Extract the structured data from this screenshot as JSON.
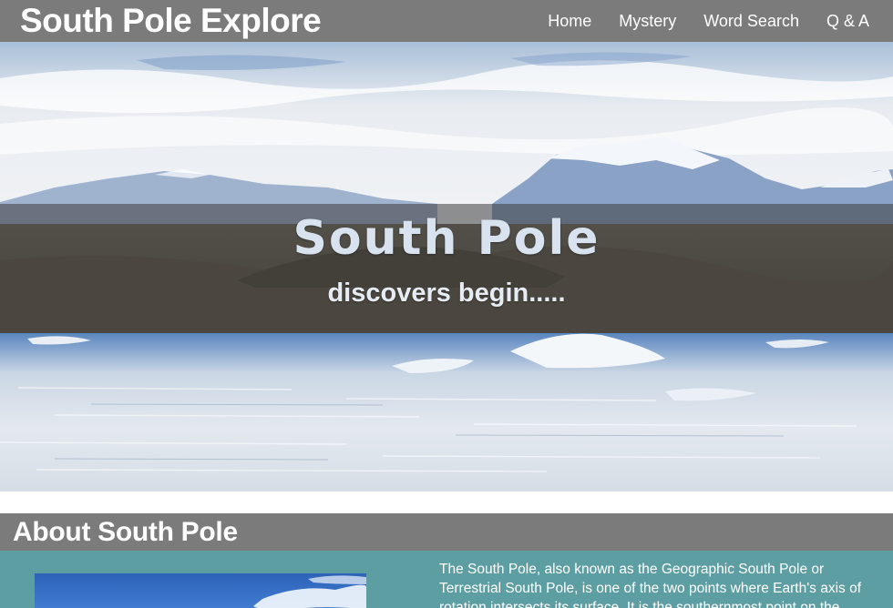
{
  "header": {
    "brand": "South Pole Explore",
    "nav": [
      {
        "label": "Home"
      },
      {
        "label": "Mystery"
      },
      {
        "label": "Word Search"
      },
      {
        "label": "Q & A"
      }
    ]
  },
  "hero": {
    "title": "South Pole",
    "subtitle": "discovers begin....."
  },
  "about": {
    "heading": "About South Pole",
    "text": "The South Pole, also known as the Geographic South Pole or Terrestrial South Pole, is one of the two points where Earth's axis of rotation intersects its surface. It is the southernmost point on the Earth."
  },
  "colors": {
    "nav_bg": "#7b7b7b",
    "about_bg": "#5d9ea2",
    "text_white": "#ffffff"
  }
}
